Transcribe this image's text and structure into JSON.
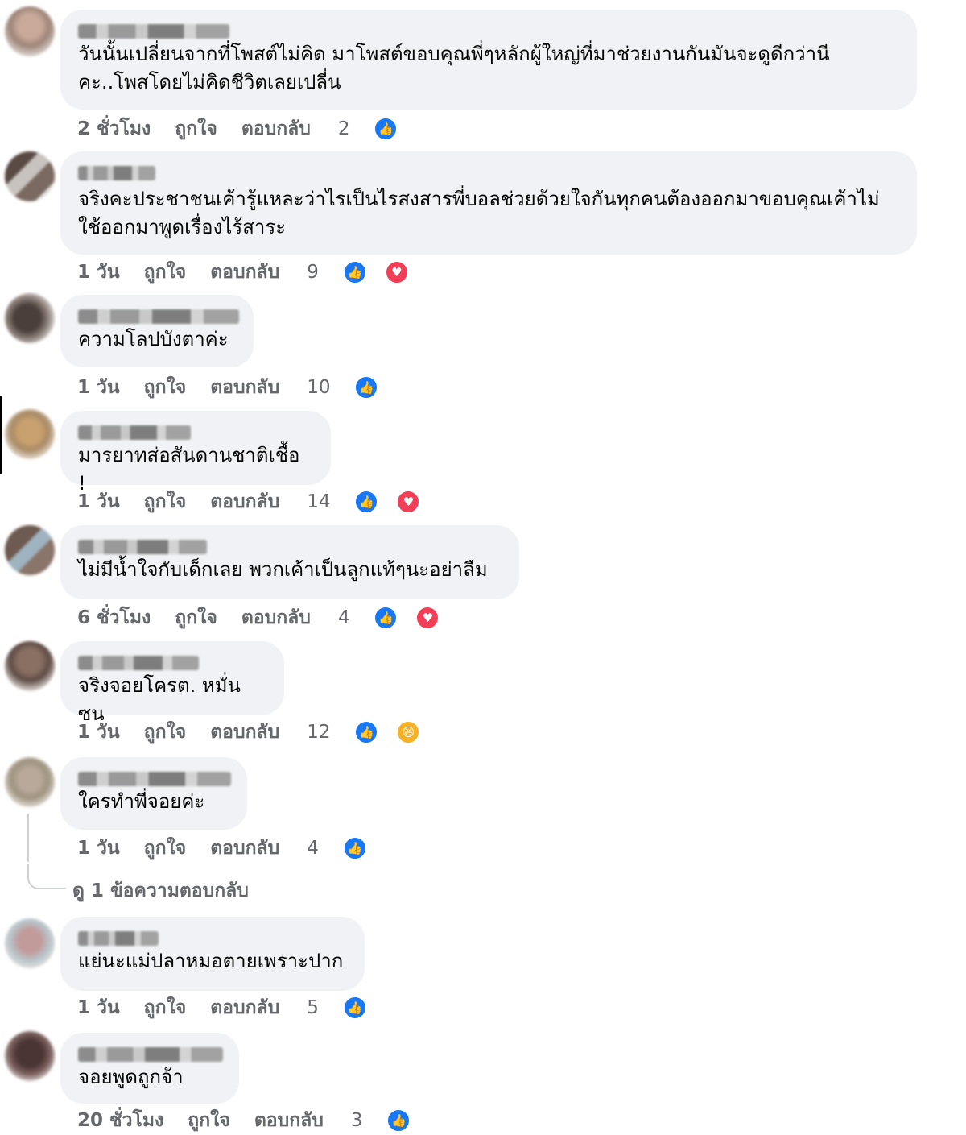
{
  "ui": {
    "like_label": "ถูกใจ",
    "reply_label": "ตอบกลับ",
    "like_icon": "thumbs-up-icon",
    "love_icon": "heart-icon",
    "haha_icon": "laughing-face-icon",
    "colors": {
      "like": "#1877f2",
      "love": "#f33e58",
      "haha": "#f7b125",
      "bubble": "#f0f2f5",
      "meta": "#65676b"
    }
  },
  "comments": [
    {
      "text": "วันนั้นเปลี่ยนจากที่โพสต์ไม่คิด มาโพสต์ขอบคุณพี่ๆหลักผู้ใหญ่ที่มาช่วยงานกันมันจะดูดีกว่านี\nคะ..โพสโดยไม่คิดชีวิตเลยเปลี่น",
      "time": "2 ชั่วโมง",
      "count": "2"
    },
    {
      "text": "จริงคะประชาชนเค้ารู้แหละว่าไรเป็นไรสงสารพี่บอลช่วยด้วยใจกันทุกคนต้องออกมาขอบคุณเค้าไม่\nใช้ออกมาพูดเรื่องไร้สาระ",
      "time": "1 วัน",
      "count": "9"
    },
    {
      "text": "ความโลปบังตาค่ะ",
      "time": "1 วัน",
      "count": "10"
    },
    {
      "text": "มารยาทส่อสันดานชาติเชื้อ !",
      "time": "1 วัน",
      "count": "14"
    },
    {
      "text": "ไม่มีน้ำใจกับเด็กเลย พวกเค้าเป็นลูกแท้ๆนะอย่าลืม",
      "time": "6 ชั่วโมง",
      "count": "4"
    },
    {
      "text": "จริงจอยโครต. หมั่นซน",
      "time": "1 วัน",
      "count": "12"
    },
    {
      "text": "ใครทำพี่จอยค่ะ",
      "time": "1 วัน",
      "count": "4",
      "view_replies": "ดู 1 ข้อความตอบกลับ"
    },
    {
      "text": "แย่นะแม่ปลาหมอตายเพราะปาก",
      "time": "1 วัน",
      "count": "5"
    },
    {
      "text": "จอยพูดถูกจ้า",
      "time": "20 ชั่วโมง",
      "count": "3"
    }
  ]
}
